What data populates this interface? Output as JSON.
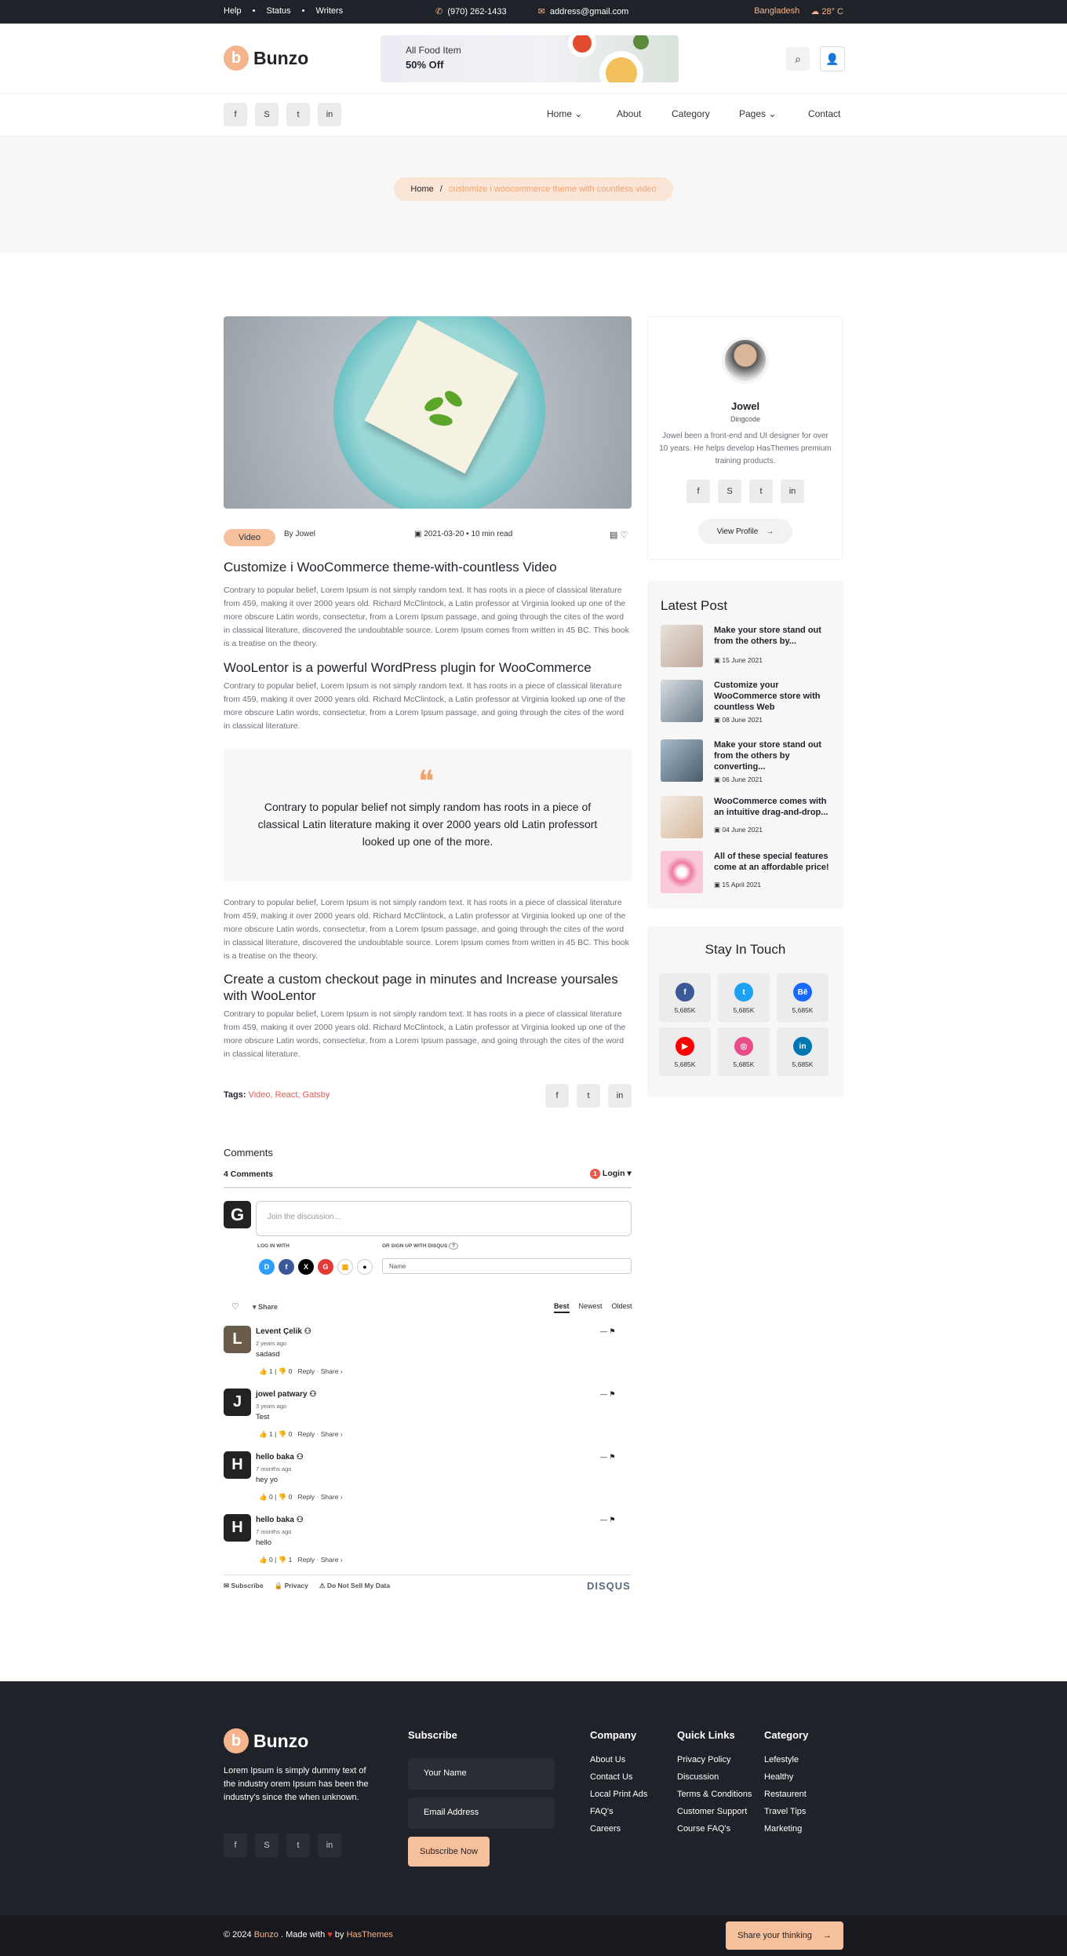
{
  "topbar": {
    "help": "Help",
    "status": "Status",
    "writers": "Writers",
    "phone": "(970) 262-1433",
    "email": "address@gmail.com",
    "location": "Bangladesh",
    "temp": "28° C"
  },
  "brand": {
    "name": "Bunzo"
  },
  "banner": {
    "line1": "All Food Item",
    "line2": "50% Off"
  },
  "nav": {
    "items": [
      "Home",
      "About",
      "Category",
      "Pages",
      "Contact"
    ]
  },
  "breadcrumb": {
    "home": "Home",
    "sep": "/",
    "current": "customize i woocommerce theme with countless video"
  },
  "post": {
    "tag": "Video",
    "author": "By Jowel",
    "date": "2021-03-20",
    "read": "10 min read",
    "title": "Customize i WooCommerce theme-with-countless Video",
    "p1": "Contrary to popular belief, Lorem Ipsum is not simply random text. It has roots in a piece of classical literature from 459, making it over 2000 years old. Richard McClintock, a Latin professor at Virginia looked up one of the more obscure Latin words, consectetur, from a Lorem Ipsum passage, and going through the cites of the word in classical literature, discovered the undoubtable source. Lorem Ipsum comes from written in 45 BC. This book is a treatise on the theory.",
    "h2": "WooLentor is a powerful WordPress plugin for WooCommerce",
    "p2": "Contrary to popular belief, Lorem Ipsum is not simply random text. It has roots in a piece of classical literature from 459, making it over 2000 years old. Richard McClintock, a Latin professor at Virginia looked up one of the more obscure Latin words, consectetur, from a Lorem Ipsum passage, and going through the cites of the word in classical literature.",
    "quote": "Contrary to popular belief not simply random has roots in a piece of classical Latin literature making it over 2000 years old Latin professort looked up one of the more.",
    "p3": "Contrary to popular belief, Lorem Ipsum is not simply random text. It has roots in a piece of classical literature from 459, making it over 2000 years old. Richard McClintock, a Latin professor at Virginia looked up one of the more obscure Latin words, consectetur, from a Lorem Ipsum passage, and going through the cites of the word in classical literature, discovered the undoubtable source. Lorem Ipsum comes from written in 45 BC. This book is a treatise on the theory.",
    "h3": "Create a custom checkout page in minutes and Increase yoursales with WooLentor",
    "p4": "Contrary to popular belief, Lorem Ipsum is not simply random text. It has roots in a piece of classical literature from 459, making it over 2000 years old. Richard McClintock, a Latin professor at Virginia looked up one of the more obscure Latin words, consectetur, from a Lorem Ipsum passage, and going through the cites of the word in classical literature.",
    "tags_label": "Tags:",
    "tags": [
      "Video,",
      "React,",
      "Gatsby"
    ]
  },
  "author": {
    "name": "Jowel",
    "company": "Dingcode",
    "bio": "Jowel been a front-end and UI designer for over 10 years. He helps develop HasThemes premium training products.",
    "btn": "View Profile"
  },
  "latest": {
    "title": "Latest Post",
    "items": [
      {
        "title": "Make your store stand out from the others by...",
        "date": "15 June 2021"
      },
      {
        "title": "Customize your WooCommerce store with countless Web",
        "date": "08 June 2021"
      },
      {
        "title": "Make your store stand out from the others by converting...",
        "date": "06 June 2021"
      },
      {
        "title": "WooCommerce comes with an intuitive drag-and-drop...",
        "date": "04 June 2021"
      },
      {
        "title": "All of these special features come at an affordable price!",
        "date": "15 April 2021"
      }
    ]
  },
  "touch": {
    "title": "Stay In Touch",
    "count": "5,685K",
    "colors": [
      "#3b5998",
      "#1da1f2",
      "#1769ff",
      "#ff0000",
      "#ea4c89",
      "#0077b5"
    ],
    "icons": [
      "f",
      "t",
      "Bē",
      "▶",
      "◎",
      "in"
    ]
  },
  "comments": {
    "heading": "Comments",
    "count": "4 Comments",
    "login": "Login",
    "badge": "1",
    "placeholder": "Join the discussion...",
    "login_with": "LOG IN WITH",
    "signup": "OR SIGN UP WITH DISQUS",
    "name_ph": "Name",
    "share": "Share",
    "sort": [
      "Best",
      "Newest",
      "Oldest"
    ],
    "list": [
      {
        "avatar": "L",
        "name": "Levent Çelik",
        "time": "2 years ago",
        "text": "sadasd",
        "up": "1",
        "down": "0"
      },
      {
        "avatar": "J",
        "name": "jowel patwary",
        "time": "3 years ago",
        "text": "Test",
        "up": "1",
        "down": "0"
      },
      {
        "avatar": "H",
        "name": "hello baka",
        "time": "7 months ago",
        "text": "hey yo",
        "up": "0",
        "down": "0"
      },
      {
        "avatar": "H",
        "name": "hello baka",
        "time": "7 months ago",
        "text": "hello",
        "up": "0",
        "down": "1"
      }
    ],
    "reply": "Reply",
    "share_link": "Share ›",
    "subscribe": "Subscribe",
    "privacy": "Privacy",
    "dnsmd": "Do Not Sell My Data",
    "disqus": "DISQUS"
  },
  "footer": {
    "about": "Lorem Ipsum is simply dummy text of the industry orem Ipsum has been the industry's since the when unknown.",
    "subscribe": "Subscribe",
    "name_ph": "Your Name",
    "email_ph": "Email Address",
    "btn": "Subscribe Now",
    "company": {
      "title": "Company",
      "items": [
        "About Us",
        "Contact Us",
        "Local Print Ads",
        "FAQ's",
        "Careers"
      ]
    },
    "quick": {
      "title": "Quick Links",
      "items": [
        "Privacy Policy",
        "Discussion",
        "Terms & Conditions",
        "Customer Support",
        "Course FAQ's"
      ]
    },
    "category": {
      "title": "Category",
      "items": [
        "Lefestyle",
        "Healthy",
        "Restaurent",
        "Travel Tips",
        "Marketing"
      ]
    },
    "copy_pre": "© 2024",
    "copy_brand": "Bunzo",
    "copy_mid": ". Made with",
    "copy_by": "by",
    "copy_author": "HasThemes",
    "share_btn": "Share your thinking"
  }
}
